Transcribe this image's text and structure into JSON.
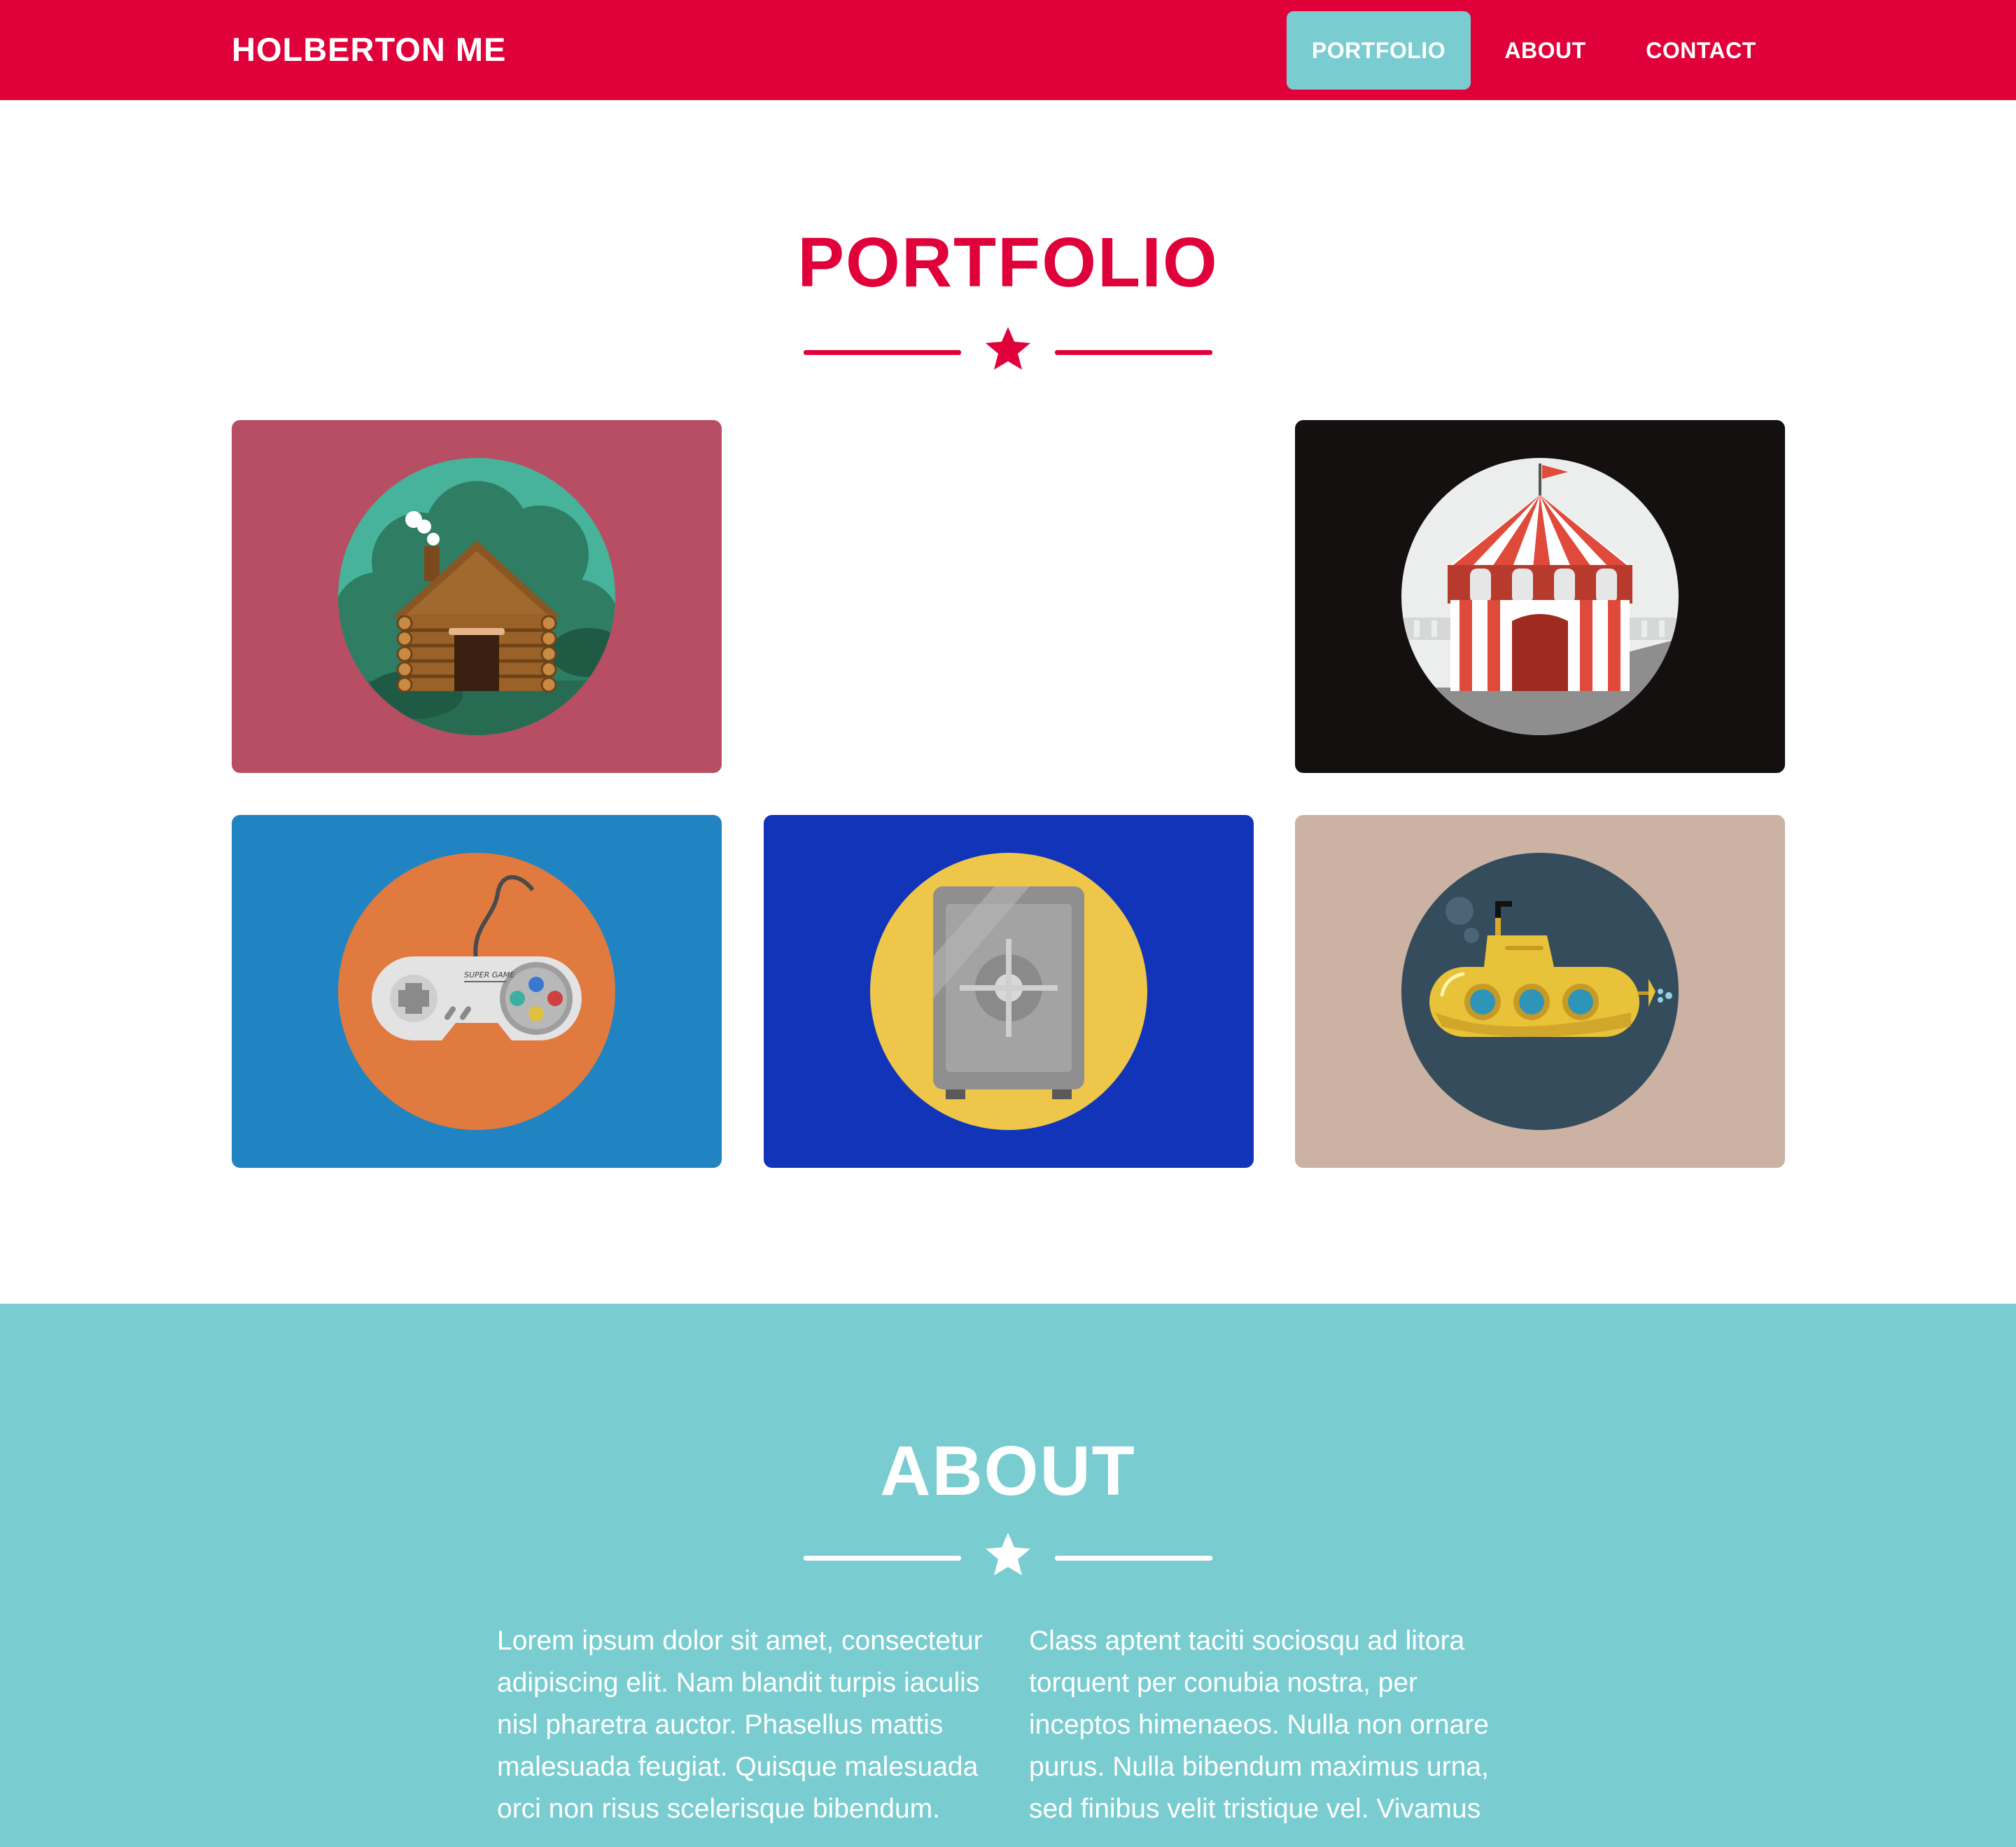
{
  "nav": {
    "brand": "HOLBERTON ME",
    "links": [
      {
        "label": "PORTFOLIO",
        "active": true
      },
      {
        "label": "ABOUT",
        "active": false
      },
      {
        "label": "CONTACT",
        "active": false
      }
    ]
  },
  "portfolio": {
    "title": "PORTFOLIO",
    "divider_icon": "star-icon",
    "items": [
      {
        "icon": "log-cabin-icon",
        "bg": "#b74e63"
      },
      {
        "icon": "circus-tent-icon",
        "bg": "#141010"
      },
      {
        "icon": "game-controller-icon",
        "bg": "#2083c2",
        "controller_text": "SUPER GAME"
      },
      {
        "icon": "safe-icon",
        "bg": "#1134b8"
      },
      {
        "icon": "submarine-icon",
        "bg": "#cbb2a3"
      }
    ]
  },
  "about": {
    "title": "ABOUT",
    "divider_icon": "star-icon",
    "col1": "Lorem ipsum dolor sit amet, consectetur adipiscing elit. Nam blandit turpis iaculis nisl pharetra auctor. Phasellus mattis malesuada feugiat. Quisque malesuada orci non risus scelerisque bibendum.",
    "col2": "Class aptent taciti sociosqu ad litora torquent per conubia nostra, per inceptos himenaeos. Nulla non ornare purus. Nulla bibendum maximus urna, sed finibus velit tristique vel. Vivamus"
  },
  "colors": {
    "primary": "#e0003a",
    "accent": "#79cdd1",
    "white": "#ffffff"
  }
}
